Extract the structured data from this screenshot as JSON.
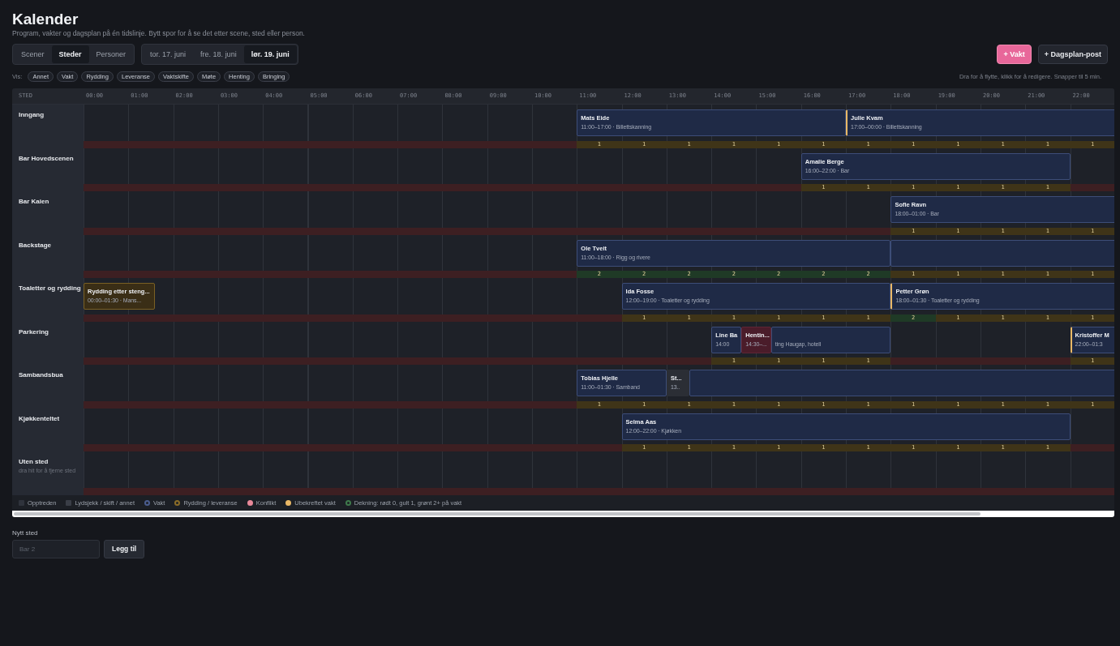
{
  "title": "Kalender",
  "subtitle": "Program, vakter og dagsplan på én tidslinje. Bytt spor for å se det etter scene, sted eller person.",
  "views": [
    {
      "label": "Scener",
      "selected": false
    },
    {
      "label": "Steder",
      "selected": true
    },
    {
      "label": "Personer",
      "selected": false
    }
  ],
  "days": [
    {
      "label": "tor. 17. juni",
      "selected": false
    },
    {
      "label": "fre. 18. juni",
      "selected": false
    },
    {
      "label": "lør. 19. juni",
      "selected": true
    }
  ],
  "actions": [
    {
      "label": "+ Vakt",
      "kind": "primary"
    },
    {
      "label": "+ Dagsplan-post",
      "kind": "secondary"
    }
  ],
  "filter_label": "Vis:",
  "filters": [
    "Annet",
    "Vakt",
    "Rydding",
    "Leveranse",
    "Vaktskifte",
    "Møte",
    "Henting",
    "Bringing"
  ],
  "hint": "Dra for å flytte, klikk for å redigere. Snapper til 5 min.",
  "timeline": {
    "corner": "STED",
    "hours": [
      "00:00",
      "01:00",
      "02:00",
      "03:00",
      "04:00",
      "05:00",
      "06:00",
      "07:00",
      "08:00",
      "09:00",
      "10:00",
      "11:00",
      "12:00",
      "13:00",
      "14:00",
      "15:00",
      "16:00",
      "17:00",
      "18:00",
      "19:00",
      "20:00",
      "21:00",
      "22:00"
    ],
    "rows": [
      {
        "name": "Inngang",
        "blocks": [
          {
            "kind": "vakt",
            "unconfirmed": false,
            "name": "Mats Eide",
            "time": "11:00–17:00 · Billettskanning"
          },
          {
            "kind": "vakt",
            "unconfirmed": true,
            "name": "Julie Kvam",
            "time": "17:00–00:00 · Billettskanning"
          }
        ],
        "coverage": [
          {
            "color": "#3d1f22"
          },
          {
            "color": "#3d1f22"
          },
          {
            "color": "#3d1f22"
          },
          {
            "color": "#3d1f22"
          },
          {
            "color": "#3d1f22"
          },
          {
            "color": "#3d1f22"
          },
          {
            "color": "#3d1f22"
          },
          {
            "color": "#3d1f22"
          },
          {
            "color": "#3d1f22"
          },
          {
            "color": "#3d1f22"
          },
          {
            "color": "#3d1f22"
          },
          {
            "count": "1",
            "color": "#3f3418"
          },
          {
            "count": "1",
            "color": "#3f3418"
          },
          {
            "count": "1",
            "color": "#3f3418"
          },
          {
            "count": "1",
            "color": "#3f3418"
          },
          {
            "count": "1",
            "color": "#3f3418"
          },
          {
            "count": "1",
            "color": "#3f3418"
          },
          {
            "count": "1",
            "color": "#3f3418"
          },
          {
            "count": "1",
            "color": "#3f3418"
          },
          {
            "count": "1",
            "color": "#3f3418"
          },
          {
            "count": "1",
            "color": "#3f3418"
          },
          {
            "count": "1",
            "color": "#3f3418"
          },
          {
            "count": "1",
            "color": "#3f3418"
          }
        ]
      },
      {
        "name": "Bar Hovedscenen",
        "blocks": [
          {
            "kind": "vakt",
            "unconfirmed": false,
            "name": "Amalie Berge",
            "time": "16:00–22:00 · Bar"
          }
        ],
        "coverage": [
          {
            "color": "#3d1f22"
          },
          {
            "color": "#3d1f22"
          },
          {
            "color": "#3d1f22"
          },
          {
            "color": "#3d1f22"
          },
          {
            "color": "#3d1f22"
          },
          {
            "color": "#3d1f22"
          },
          {
            "color": "#3d1f22"
          },
          {
            "color": "#3d1f22"
          },
          {
            "color": "#3d1f22"
          },
          {
            "color": "#3d1f22"
          },
          {
            "color": "#3d1f22"
          },
          {
            "color": "#3d1f22"
          },
          {
            "color": "#3d1f22"
          },
          {
            "color": "#3d1f22"
          },
          {
            "color": "#3d1f22"
          },
          {
            "color": "#3d1f22"
          },
          {
            "count": "1",
            "color": "#3f3418"
          },
          {
            "count": "1",
            "color": "#3f3418"
          },
          {
            "count": "1",
            "color": "#3f3418"
          },
          {
            "count": "1",
            "color": "#3f3418"
          },
          {
            "count": "1",
            "color": "#3f3418"
          },
          {
            "count": "1",
            "color": "#3f3418"
          },
          {
            "color": "#3d1f22"
          }
        ]
      },
      {
        "name": "Bar Kaien",
        "blocks": [
          {
            "kind": "vakt",
            "unconfirmed": false,
            "name": "Sofie Ravn",
            "time": "18:00–01:00 · Bar"
          }
        ],
        "coverage": [
          {
            "color": "#3d1f22"
          },
          {
            "color": "#3d1f22"
          },
          {
            "color": "#3d1f22"
          },
          {
            "color": "#3d1f22"
          },
          {
            "color": "#3d1f22"
          },
          {
            "color": "#3d1f22"
          },
          {
            "color": "#3d1f22"
          },
          {
            "color": "#3d1f22"
          },
          {
            "color": "#3d1f22"
          },
          {
            "color": "#3d1f22"
          },
          {
            "color": "#3d1f22"
          },
          {
            "color": "#3d1f22"
          },
          {
            "color": "#3d1f22"
          },
          {
            "color": "#3d1f22"
          },
          {
            "color": "#3d1f22"
          },
          {
            "color": "#3d1f22"
          },
          {
            "color": "#3d1f22"
          },
          {
            "color": "#3d1f22"
          },
          {
            "count": "1",
            "color": "#3f3418"
          },
          {
            "count": "1",
            "color": "#3f3418"
          },
          {
            "count": "1",
            "color": "#3f3418"
          },
          {
            "count": "1",
            "color": "#3f3418"
          },
          {
            "count": "1",
            "color": "#3f3418"
          }
        ]
      },
      {
        "name": "Backstage",
        "blocks": [
          {
            "kind": "vakt",
            "unconfirmed": false,
            "name": "Ole Tveit",
            "time": "11:00–18:00 · Rigg og rivere"
          },
          {
            "kind": "vakt",
            "unconfirmed": false
          }
        ],
        "coverage": [
          {
            "color": "#3d1f22"
          },
          {
            "color": "#3d1f22"
          },
          {
            "color": "#3d1f22"
          },
          {
            "color": "#3d1f22"
          },
          {
            "color": "#3d1f22"
          },
          {
            "color": "#3d1f22"
          },
          {
            "color": "#3d1f22"
          },
          {
            "color": "#3d1f22"
          },
          {
            "color": "#3d1f22"
          },
          {
            "color": "#3d1f22"
          },
          {
            "color": "#3d1f22"
          },
          {
            "count": "2",
            "color": "#1f3a26"
          },
          {
            "count": "2",
            "color": "#1f3a26"
          },
          {
            "count": "2",
            "color": "#1f3a26"
          },
          {
            "count": "2",
            "color": "#1f3a26"
          },
          {
            "count": "2",
            "color": "#1f3a26"
          },
          {
            "count": "2",
            "color": "#1f3a26"
          },
          {
            "count": "2",
            "color": "#1f3a26"
          },
          {
            "count": "1",
            "color": "#3f3418"
          },
          {
            "count": "1",
            "color": "#3f3418"
          },
          {
            "count": "1",
            "color": "#3f3418"
          },
          {
            "count": "1",
            "color": "#3f3418"
          },
          {
            "count": "1",
            "color": "#3f3418"
          }
        ]
      },
      {
        "name": "Toaletter og rydding",
        "blocks": [
          {
            "kind": "rydding",
            "unconfirmed": false,
            "name": "Rydding etter steng...",
            "time": "00:00–01:30 · Mans..."
          },
          {
            "kind": "vakt",
            "unconfirmed": false,
            "name": "Ida Fosse",
            "time": "12:00–19:00 · Toaletter og rydding"
          },
          {
            "kind": "vakt",
            "unconfirmed": true,
            "name": "Petter Grøn",
            "time": "18:00–01:30 · Toaletter og rydding"
          }
        ],
        "coverage": [
          {
            "color": "#3d1f22"
          },
          {
            "color": "#3d1f22"
          },
          {
            "color": "#3d1f22"
          },
          {
            "color": "#3d1f22"
          },
          {
            "color": "#3d1f22"
          },
          {
            "color": "#3d1f22"
          },
          {
            "color": "#3d1f22"
          },
          {
            "color": "#3d1f22"
          },
          {
            "color": "#3d1f22"
          },
          {
            "color": "#3d1f22"
          },
          {
            "color": "#3d1f22"
          },
          {
            "color": "#3d1f22"
          },
          {
            "count": "1",
            "color": "#3f3418"
          },
          {
            "count": "1",
            "color": "#3f3418"
          },
          {
            "count": "1",
            "color": "#3f3418"
          },
          {
            "count": "1",
            "color": "#3f3418"
          },
          {
            "count": "1",
            "color": "#3f3418"
          },
          {
            "count": "1",
            "color": "#3f3418"
          },
          {
            "count": "2",
            "color": "#1f3a26"
          },
          {
            "count": "1",
            "color": "#3f3418"
          },
          {
            "count": "1",
            "color": "#3f3418"
          },
          {
            "count": "1",
            "color": "#3f3418"
          },
          {
            "count": "1",
            "color": "#3f3418"
          }
        ]
      },
      {
        "name": "Parkering",
        "blocks": [
          {
            "kind": "vakt",
            "unconfirmed": false,
            "name": "Line Ba",
            "time": "14:00"
          },
          {
            "kind": "konflikt",
            "unconfirmed": false,
            "name": "Hentin...",
            "time": "14:30–..."
          },
          {
            "kind": "vakt",
            "unconfirmed": false,
            "detail": "ting Haugap, hotell"
          },
          {
            "kind": "vakt",
            "unconfirmed": true,
            "name": "Kristoffer M",
            "time": "22:00–01:3"
          }
        ],
        "coverage": [
          {
            "color": "#3d1f22"
          },
          {
            "color": "#3d1f22"
          },
          {
            "color": "#3d1f22"
          },
          {
            "color": "#3d1f22"
          },
          {
            "color": "#3d1f22"
          },
          {
            "color": "#3d1f22"
          },
          {
            "color": "#3d1f22"
          },
          {
            "color": "#3d1f22"
          },
          {
            "color": "#3d1f22"
          },
          {
            "color": "#3d1f22"
          },
          {
            "color": "#3d1f22"
          },
          {
            "color": "#3d1f22"
          },
          {
            "color": "#3d1f22"
          },
          {
            "color": "#3d1f22"
          },
          {
            "count": "1",
            "color": "#3f3418"
          },
          {
            "count": "1",
            "color": "#3f3418"
          },
          {
            "count": "1",
            "color": "#3f3418"
          },
          {
            "count": "1",
            "color": "#3f3418"
          },
          {
            "color": "#3d1f22"
          },
          {
            "color": "#3d1f22"
          },
          {
            "color": "#3d1f22"
          },
          {
            "color": "#3d1f22"
          },
          {
            "count": "1",
            "color": "#3f3418"
          }
        ]
      },
      {
        "name": "Sambandsbua",
        "blocks": [
          {
            "kind": "vakt",
            "unconfirmed": false,
            "name": "Tobias Hjelle",
            "time": "11:00–01:30 · Samband"
          },
          {
            "kind": "annet",
            "unconfirmed": false,
            "name": "St...",
            "time": "13.."
          },
          {
            "kind": "vakt",
            "unconfirmed": false
          }
        ],
        "coverage": [
          {
            "color": "#3d1f22"
          },
          {
            "color": "#3d1f22"
          },
          {
            "color": "#3d1f22"
          },
          {
            "color": "#3d1f22"
          },
          {
            "color": "#3d1f22"
          },
          {
            "color": "#3d1f22"
          },
          {
            "color": "#3d1f22"
          },
          {
            "color": "#3d1f22"
          },
          {
            "color": "#3d1f22"
          },
          {
            "color": "#3d1f22"
          },
          {
            "color": "#3d1f22"
          },
          {
            "count": "1",
            "color": "#3f3418"
          },
          {
            "count": "1",
            "color": "#3f3418"
          },
          {
            "count": "1",
            "color": "#3f3418"
          },
          {
            "count": "1",
            "color": "#3f3418"
          },
          {
            "count": "1",
            "color": "#3f3418"
          },
          {
            "count": "1",
            "color": "#3f3418"
          },
          {
            "count": "1",
            "color": "#3f3418"
          },
          {
            "count": "1",
            "color": "#3f3418"
          },
          {
            "count": "1",
            "color": "#3f3418"
          },
          {
            "count": "1",
            "color": "#3f3418"
          },
          {
            "count": "1",
            "color": "#3f3418"
          },
          {
            "count": "1",
            "color": "#3f3418"
          }
        ]
      },
      {
        "name": "Kjøkkenteltet",
        "blocks": [
          {
            "kind": "vakt",
            "unconfirmed": false,
            "name": "Selma Aas",
            "time": "12:00–22:00 · Kjøkken"
          }
        ],
        "coverage": [
          {
            "color": "#3d1f22"
          },
          {
            "color": "#3d1f22"
          },
          {
            "color": "#3d1f22"
          },
          {
            "color": "#3d1f22"
          },
          {
            "color": "#3d1f22"
          },
          {
            "color": "#3d1f22"
          },
          {
            "color": "#3d1f22"
          },
          {
            "color": "#3d1f22"
          },
          {
            "color": "#3d1f22"
          },
          {
            "color": "#3d1f22"
          },
          {
            "color": "#3d1f22"
          },
          {
            "color": "#3d1f22"
          },
          {
            "count": "1",
            "color": "#3f3418"
          },
          {
            "count": "1",
            "color": "#3f3418"
          },
          {
            "count": "1",
            "color": "#3f3418"
          },
          {
            "count": "1",
            "color": "#3f3418"
          },
          {
            "count": "1",
            "color": "#3f3418"
          },
          {
            "count": "1",
            "color": "#3f3418"
          },
          {
            "count": "1",
            "color": "#3f3418"
          },
          {
            "count": "1",
            "color": "#3f3418"
          },
          {
            "count": "1",
            "color": "#3f3418"
          },
          {
            "count": "1",
            "color": "#3f3418"
          },
          {
            "color": "#3d1f22"
          }
        ]
      },
      {
        "name": "Uten sted",
        "note": "dra hit for å fjerne sted",
        "coverage": [
          {
            "color": "#3d1f22"
          },
          {
            "color": "#3d1f22"
          },
          {
            "color": "#3d1f22"
          },
          {
            "color": "#3d1f22"
          },
          {
            "color": "#3d1f22"
          },
          {
            "color": "#3d1f22"
          },
          {
            "color": "#3d1f22"
          },
          {
            "color": "#3d1f22"
          },
          {
            "color": "#3d1f22"
          },
          {
            "color": "#3d1f22"
          },
          {
            "color": "#3d1f22"
          },
          {
            "color": "#3d1f22"
          },
          {
            "color": "#3d1f22"
          },
          {
            "color": "#3d1f22"
          },
          {
            "color": "#3d1f22"
          },
          {
            "color": "#3d1f22"
          },
          {
            "color": "#3d1f22"
          },
          {
            "color": "#3d1f22"
          },
          {
            "color": "#3d1f22"
          },
          {
            "color": "#3d1f22"
          },
          {
            "color": "#3d1f22"
          },
          {
            "color": "#3d1f22"
          },
          {
            "color": "#3d1f22"
          }
        ]
      }
    ],
    "legend": [
      {
        "label": "Opptreden",
        "kind": "square",
        "color": "#2f333c"
      },
      {
        "label": "Lydsjekk / skift / annet",
        "kind": "square",
        "color": "#3a3e47"
      },
      {
        "label": "Vakt",
        "kind": "ring",
        "color": "#4a5d8f"
      },
      {
        "label": "Rydding / leveranse",
        "kind": "ring",
        "color": "#8a6c28"
      },
      {
        "label": "Konflikt",
        "kind": "dot",
        "color": "#e8899a"
      },
      {
        "label": "Ubekreftet vakt",
        "kind": "dot",
        "color": "#e9b866"
      },
      {
        "label": "Dekning: rødt 0, gult 1, grønt 2+ på vakt",
        "kind": "ring",
        "color": "#3f7a4c"
      }
    ]
  },
  "new_place": {
    "label": "Nytt sted",
    "placeholder": "Bar 2",
    "button": "Legg til"
  }
}
